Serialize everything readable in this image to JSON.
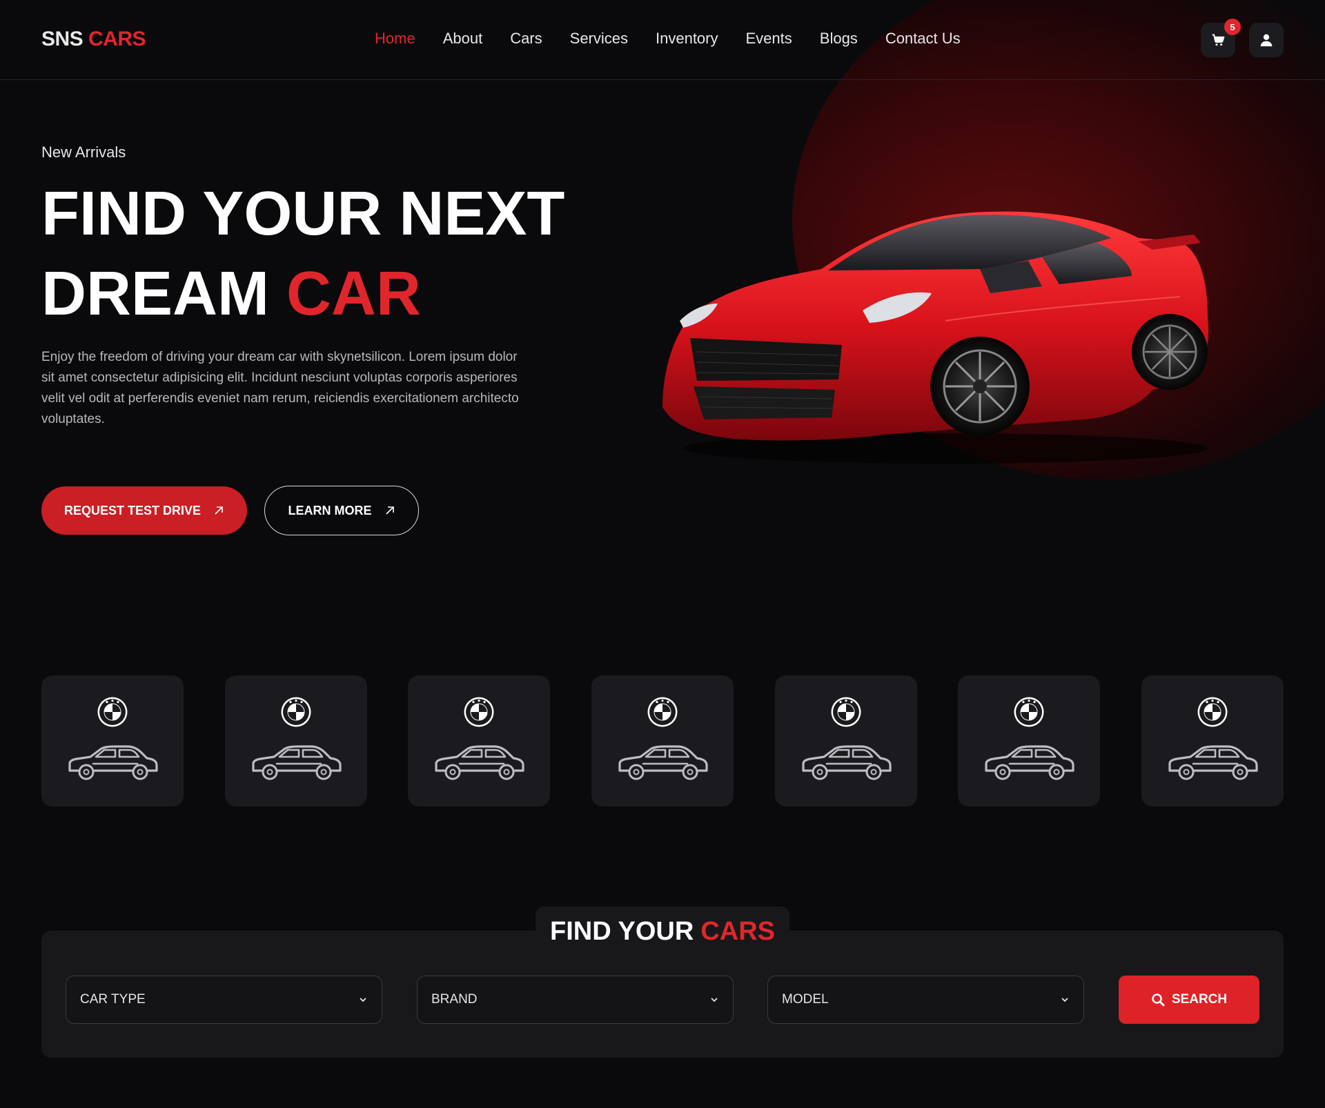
{
  "brand": {
    "name_main": "SNS",
    "name_accent": "CARS"
  },
  "nav": {
    "items": [
      "Home",
      "About",
      "Cars",
      "Services",
      "Inventory",
      "Events",
      "Blogs",
      "Contact Us"
    ],
    "active": "Home"
  },
  "header": {
    "cart_count": "5",
    "cart_icon": "cart-icon",
    "user_icon": "user-icon"
  },
  "hero": {
    "eyebrow": "New Arrivals",
    "title_line1": "FIND YOUR NEXT",
    "title_line2_main": "DREAM",
    "title_line2_accent": "CAR",
    "description": "Enjoy the freedom of driving your dream car with skynetsilicon. Lorem ipsum dolor sit amet consectetur adipisicing elit. Incidunt nesciunt voluptas corporis asperiores velit vel odit at perferendis eveniet nam rerum, reiciendis exercitationem architecto voluptates.",
    "primary_button": "REQUEST TEST DRIVE",
    "secondary_button": "LEARN MORE"
  },
  "brand_cards": [
    {
      "logo": "bmw-logo",
      "icon": "sedan-icon"
    },
    {
      "logo": "bmw-logo",
      "icon": "sedan-icon"
    },
    {
      "logo": "bmw-logo",
      "icon": "sedan-icon"
    },
    {
      "logo": "bmw-logo",
      "icon": "sedan-icon"
    },
    {
      "logo": "bmw-logo",
      "icon": "sedan-icon"
    },
    {
      "logo": "bmw-logo",
      "icon": "sedan-icon"
    },
    {
      "logo": "bmw-logo",
      "icon": "sedan-icon"
    }
  ],
  "finder": {
    "title_main": "FIND YOUR",
    "title_accent": "CARS",
    "car_type_label": "CAR TYPE",
    "brand_label": "BRAND",
    "model_label": "MODEL",
    "search_label": "SEARCH"
  },
  "colors": {
    "accent": "#e0262c",
    "background": "#0a0a0c",
    "card": "#1b1b1f"
  }
}
